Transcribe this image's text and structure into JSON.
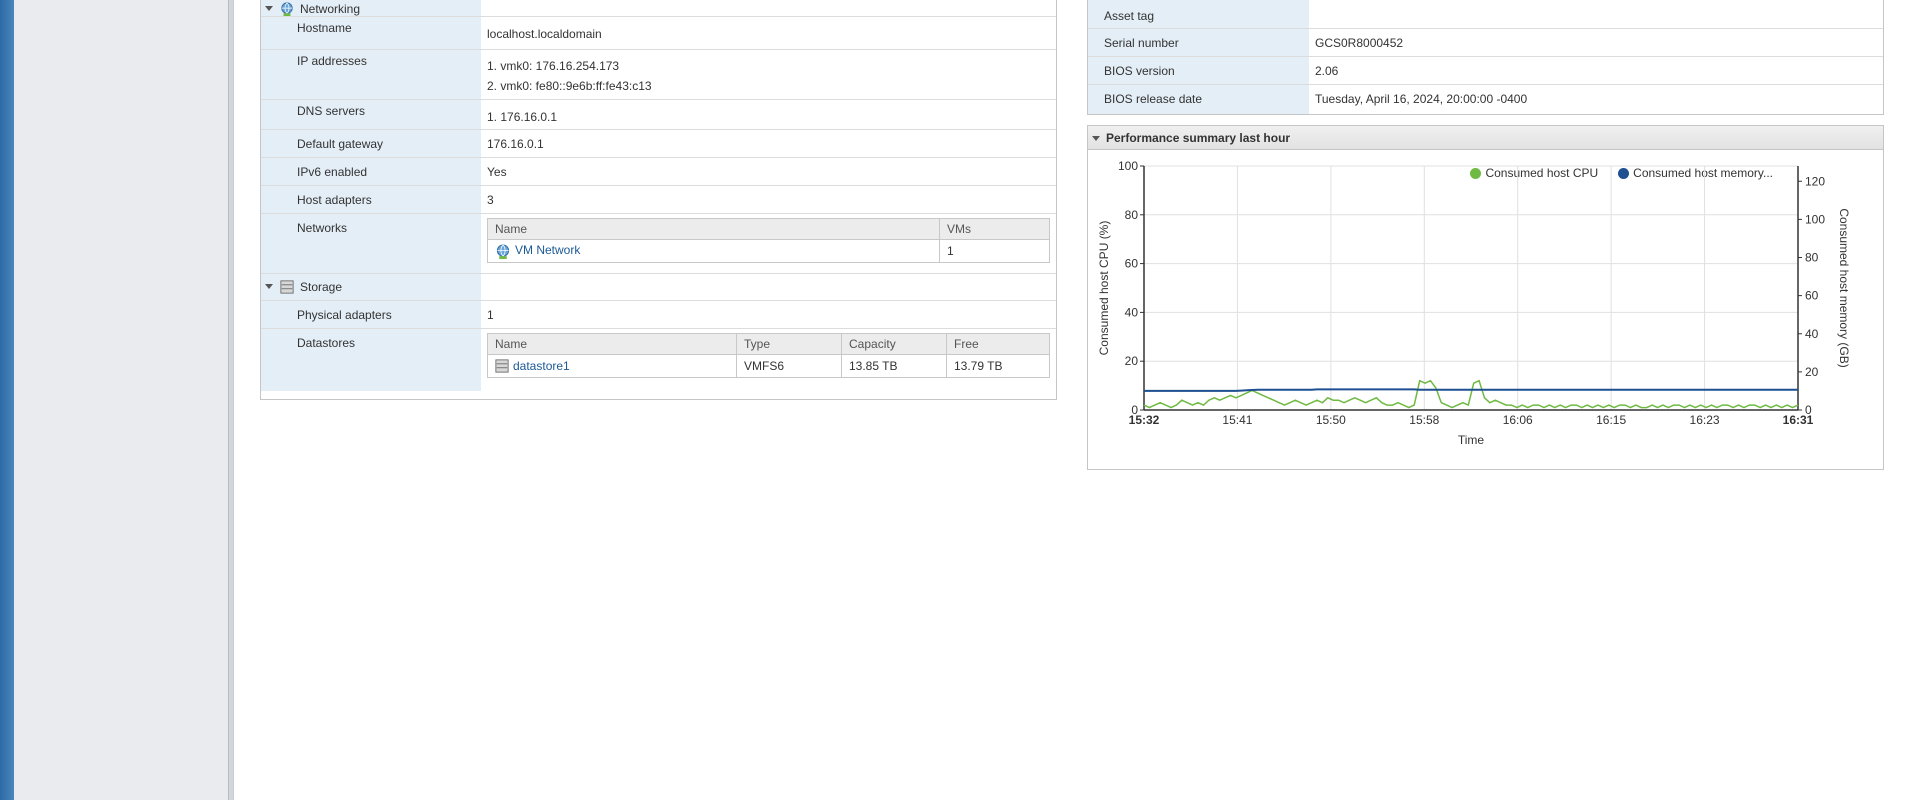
{
  "networking": {
    "section_label": "Networking",
    "rows": [
      {
        "label": "Hostname",
        "lines": [
          "localhost.localdomain"
        ]
      },
      {
        "label": "IP addresses",
        "lines": [
          "1. vmk0: 176.16.254.173",
          "2. vmk0: fe80::9e6b:ff:fe43:c13"
        ]
      },
      {
        "label": "DNS servers",
        "lines": [
          "1. 176.16.0.1"
        ]
      },
      {
        "label": "Default gateway",
        "lines": [
          "176.16.0.1"
        ]
      },
      {
        "label": "IPv6 enabled",
        "lines": [
          "Yes"
        ]
      },
      {
        "label": "Host adapters",
        "lines": [
          "3"
        ]
      }
    ],
    "networks_label": "Networks",
    "networks_table": {
      "headers": [
        "Name",
        "VMs"
      ],
      "rows": [
        {
          "name": "VM Network",
          "vms": "1"
        }
      ]
    }
  },
  "storage": {
    "section_label": "Storage",
    "physical_adapters_label": "Physical adapters",
    "physical_adapters_value": "1",
    "datastores_label": "Datastores",
    "datastores_table": {
      "headers": [
        "Name",
        "Type",
        "Capacity",
        "Free"
      ],
      "rows": [
        {
          "name": "datastore1",
          "type": "VMFS6",
          "capacity": "13.85 TB",
          "free": "13.79 TB"
        }
      ]
    }
  },
  "hardware": {
    "rows": [
      {
        "label": "Asset tag",
        "value": ""
      },
      {
        "label": "Serial number",
        "value": "GCS0R8000452"
      },
      {
        "label": "BIOS version",
        "value": "2.06"
      },
      {
        "label": "BIOS release date",
        "value": "Tuesday, April 16, 2024, 20:00:00 -0400"
      }
    ]
  },
  "performance": {
    "title": "Performance summary last hour"
  },
  "colors": {
    "cpu": "#6fba43",
    "memory": "#1d4f91",
    "label_bg": "#e4eef6"
  },
  "chart_data": {
    "type": "line",
    "xlabel": "Time",
    "ylabel_left": "Consumed host CPU (%)",
    "ylabel_right": "Consumed host memory (GB)",
    "x_ticks": [
      "15:32",
      "15:41",
      "15:50",
      "15:58",
      "16:06",
      "16:15",
      "16:23",
      "16:31"
    ],
    "ylim_left": [
      0,
      100
    ],
    "ylim_right": [
      0,
      128
    ],
    "y_ticks_left": [
      0,
      20,
      40,
      60,
      80,
      100
    ],
    "y_ticks_right": [
      0,
      20,
      40,
      60,
      80,
      100,
      120
    ],
    "grid": true,
    "legend_position": "top-right",
    "series": [
      {
        "name": "Consumed host CPU",
        "axis": "left",
        "values": [
          2,
          1,
          2,
          3,
          2,
          1,
          2,
          4,
          3,
          2,
          3,
          2,
          4,
          5,
          4,
          5,
          6,
          5,
          6,
          7,
          8,
          7,
          6,
          5,
          4,
          3,
          2,
          3,
          4,
          3,
          2,
          3,
          4,
          3,
          5,
          4,
          4,
          3,
          4,
          5,
          4,
          3,
          4,
          5,
          3,
          2,
          2,
          3,
          2,
          1,
          2,
          12,
          11,
          12,
          9,
          3,
          2,
          1,
          2,
          3,
          2,
          11,
          12,
          5,
          3,
          4,
          3,
          2,
          2,
          1,
          2,
          1,
          2,
          2,
          1,
          2,
          1,
          2,
          1,
          2,
          2,
          1,
          2,
          1,
          2,
          1,
          2,
          1,
          2,
          2,
          1,
          2,
          1,
          1,
          2,
          1,
          2,
          1,
          2,
          2,
          1,
          2,
          1,
          2,
          1,
          2,
          1,
          2,
          2,
          1,
          2,
          1,
          2,
          2,
          1,
          2,
          1,
          2,
          1,
          2,
          1,
          2
        ]
      },
      {
        "name": "Consumed host memory...",
        "axis": "right",
        "values": [
          10,
          10,
          10,
          10,
          10,
          10,
          10,
          10,
          10,
          10,
          10,
          10,
          10,
          10,
          10,
          10,
          10,
          10,
          10.2,
          10.4,
          10.5,
          10.6,
          10.6,
          10.6,
          10.6,
          10.6,
          10.6,
          10.6,
          10.6,
          10.6,
          10.6,
          10.6,
          10.8,
          10.8,
          10.8,
          10.8,
          10.8,
          10.8,
          10.8,
          10.8,
          10.8,
          10.8,
          10.8,
          10.8,
          10.8,
          10.8,
          10.8,
          10.8,
          10.8,
          10.8,
          10.8,
          10.6,
          10.6,
          10.6,
          10.6,
          10.6,
          10.6,
          10.6,
          10.6,
          10.6,
          10.6,
          10.6,
          10.6,
          10.6,
          10.6,
          10.6,
          10.6,
          10.6,
          10.6,
          10.6,
          10.6,
          10.6,
          10.6,
          10.6,
          10.6,
          10.6,
          10.6,
          10.6,
          10.6,
          10.6,
          10.6,
          10.6,
          10.6,
          10.6,
          10.6,
          10.6,
          10.6,
          10.6,
          10.6,
          10.6,
          10.6,
          10.6,
          10.6,
          10.6,
          10.6,
          10.6,
          10.6,
          10.6,
          10.6,
          10.6,
          10.6,
          10.6,
          10.6,
          10.6,
          10.6,
          10.6,
          10.6,
          10.6,
          10.6,
          10.6,
          10.6,
          10.6,
          10.6,
          10.6,
          10.6,
          10.6,
          10.6,
          10.6,
          10.6,
          10.6,
          10.6,
          10.6
        ]
      }
    ]
  }
}
